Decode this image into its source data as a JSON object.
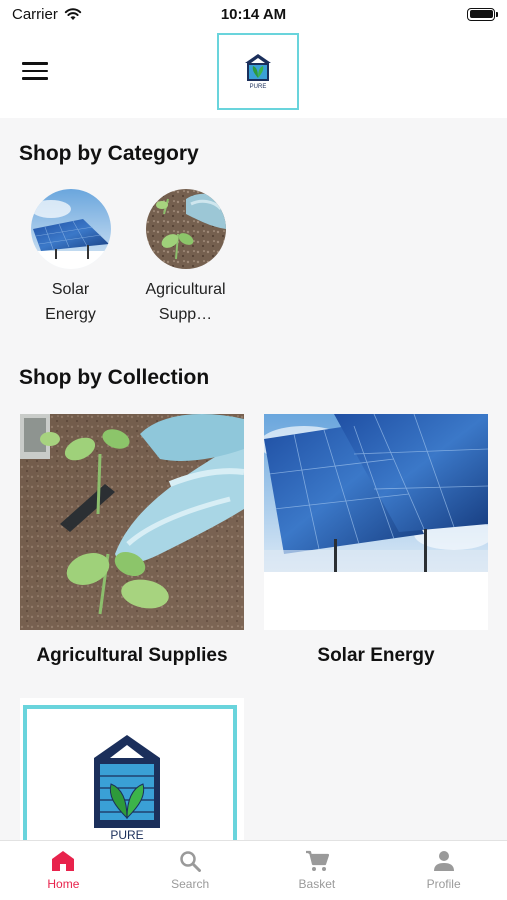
{
  "status_bar": {
    "carrier": "Carrier",
    "time": "10:14 AM"
  },
  "header": {
    "logo_text": "PURE"
  },
  "categories_section": {
    "title": "Shop by Category",
    "items": [
      {
        "label": "Solar Energy",
        "image": "solar-panels"
      },
      {
        "label": "Agricultural Supp…",
        "image": "seedlings-gloves"
      }
    ]
  },
  "collections_section": {
    "title": "Shop by Collection",
    "items": [
      {
        "label": "Agricultural Supplies",
        "image": "seedlings-gloves"
      },
      {
        "label": "Solar Energy",
        "image": "solar-panels"
      },
      {
        "label": "",
        "image": "pure-logo"
      }
    ]
  },
  "tab_bar": {
    "active_color": "#e8234c",
    "inactive_color": "#9a9a9a",
    "items": [
      {
        "label": "Home",
        "icon": "home-icon",
        "active": true
      },
      {
        "label": "Search",
        "icon": "search-icon",
        "active": false
      },
      {
        "label": "Basket",
        "icon": "cart-icon",
        "active": false
      },
      {
        "label": "Profile",
        "icon": "person-icon",
        "active": false
      }
    ]
  }
}
